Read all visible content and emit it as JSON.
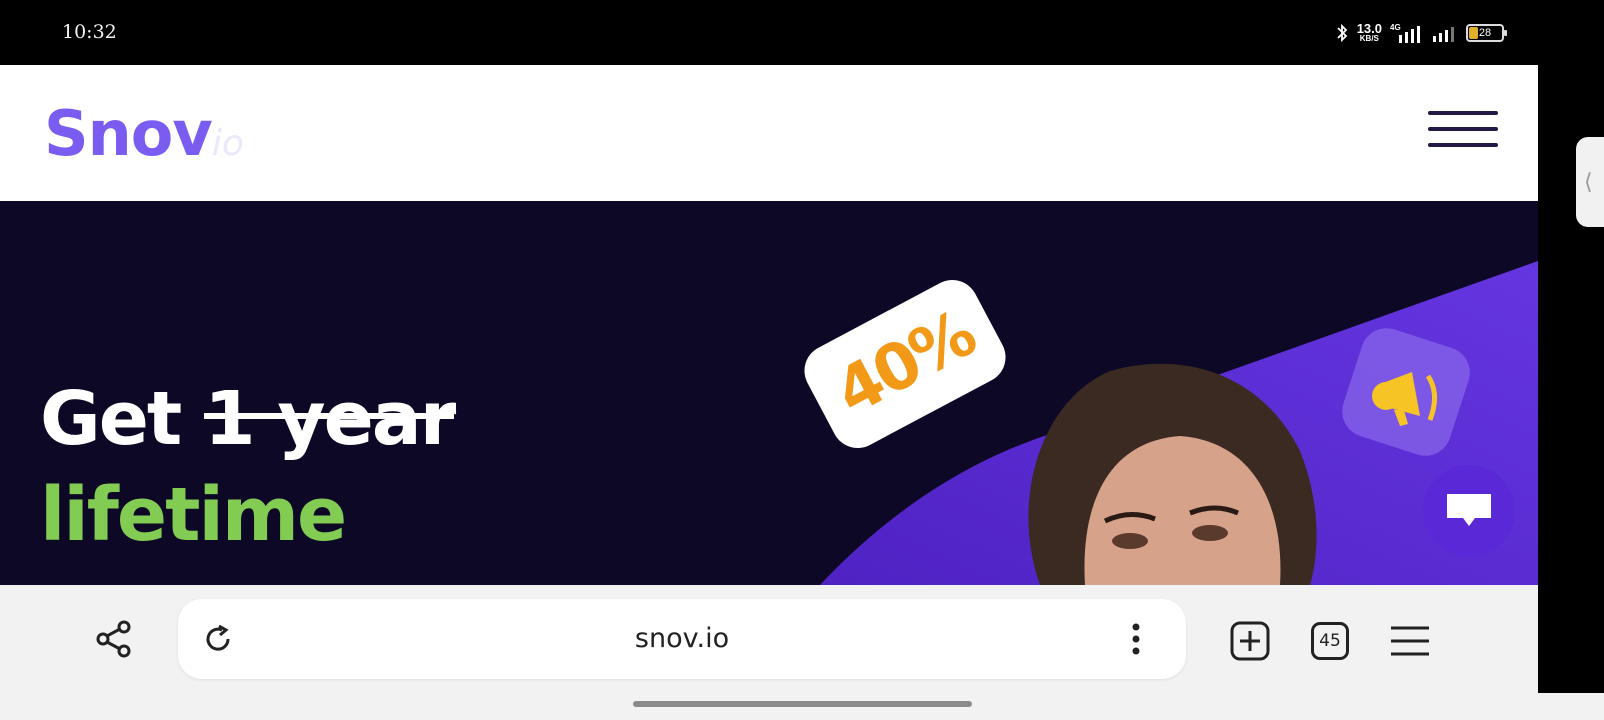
{
  "status_bar": {
    "time": "10:32",
    "net_speed": "13.0",
    "net_speed_unit": "KB/S",
    "network_type": "4G",
    "battery_level": "28"
  },
  "site": {
    "logo_main": "Snov",
    "logo_suffix": "io"
  },
  "hero": {
    "prefix": "Get",
    "struck_text": "1 year",
    "highlight": "lifetime",
    "badge": "40%"
  },
  "browser": {
    "url": "snov.io",
    "tab_count": "45"
  },
  "colors": {
    "brand_purple": "#7b5cf0",
    "hero_bg": "#0e0827",
    "accent_green": "#82cc53",
    "badge_orange": "#f29a17",
    "chat_purple": "#5a28d6"
  }
}
